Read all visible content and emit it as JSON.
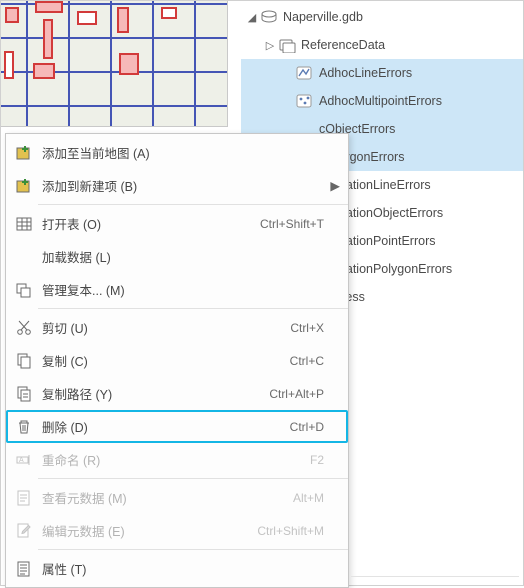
{
  "tree": {
    "root": {
      "label": "Naperville.gdb",
      "expanded": true
    },
    "dataset": {
      "label": "ReferenceData",
      "expanded": false
    },
    "layers": [
      {
        "label": "AdhocLineErrors",
        "type": "line",
        "selected": true,
        "clipped": false
      },
      {
        "label": "AdhocMultipointErrors",
        "type": "mpoint",
        "selected": true,
        "clipped": false
      },
      {
        "label": "cObjectErrors",
        "type": "line",
        "selected": true,
        "clipped": true
      },
      {
        "label": "cPolygonErrors",
        "type": "line",
        "selected": true,
        "clipped": true
      },
      {
        "label": "ValidationLineErrors",
        "type": "line",
        "selected": false,
        "clipped": true
      },
      {
        "label": "ValidationObjectErrors",
        "type": "line",
        "selected": false,
        "clipped": true
      },
      {
        "label": "ValidationPointErrors",
        "type": "line",
        "selected": false,
        "clipped": true
      },
      {
        "label": "ValidationPolygonErrors",
        "type": "line",
        "selected": false,
        "clipped": true
      },
      {
        "label": "Address",
        "type": "line",
        "selected": false,
        "clipped": true
      }
    ]
  },
  "ctx": {
    "items": [
      {
        "icon": "map-add",
        "label": "添加至当前地图 (A)",
        "shortcut": "",
        "sub": false,
        "enabled": true
      },
      {
        "icon": "map-new",
        "label": "添加到新建项 (B)",
        "shortcut": "",
        "sub": true,
        "enabled": true
      },
      {
        "sep": true
      },
      {
        "icon": "table",
        "label": "打开表 (O)",
        "shortcut": "Ctrl+Shift+T",
        "sub": false,
        "enabled": true
      },
      {
        "icon": "",
        "label": "加载数据 (L)",
        "shortcut": "",
        "sub": false,
        "enabled": true
      },
      {
        "icon": "replica",
        "label": "管理复本... (M)",
        "shortcut": "",
        "sub": false,
        "enabled": true
      },
      {
        "sep": true
      },
      {
        "icon": "cut",
        "label": "剪切 (U)",
        "shortcut": "Ctrl+X",
        "sub": false,
        "enabled": true
      },
      {
        "icon": "copy",
        "label": "复制 (C)",
        "shortcut": "Ctrl+C",
        "sub": false,
        "enabled": true
      },
      {
        "icon": "copypath",
        "label": "复制路径 (Y)",
        "shortcut": "Ctrl+Alt+P",
        "sub": false,
        "enabled": true
      },
      {
        "icon": "trash",
        "label": "删除 (D)",
        "shortcut": "Ctrl+D",
        "sub": false,
        "enabled": true,
        "hl": true
      },
      {
        "icon": "rename",
        "label": "重命名 (R)",
        "shortcut": "F2",
        "sub": false,
        "enabled": false
      },
      {
        "sep": true
      },
      {
        "icon": "view-meta",
        "label": "查看元数据 (M)",
        "shortcut": "Alt+M",
        "sub": false,
        "enabled": false
      },
      {
        "icon": "edit-meta",
        "label": "编辑元数据 (E)",
        "shortcut": "Ctrl+Shift+M",
        "sub": false,
        "enabled": false
      },
      {
        "sep": true
      },
      {
        "icon": "props",
        "label": "属性 (T)",
        "shortcut": "",
        "sub": false,
        "enabled": true
      }
    ]
  },
  "icons": {
    "gdb": "gdb",
    "dataset": "dataset"
  }
}
